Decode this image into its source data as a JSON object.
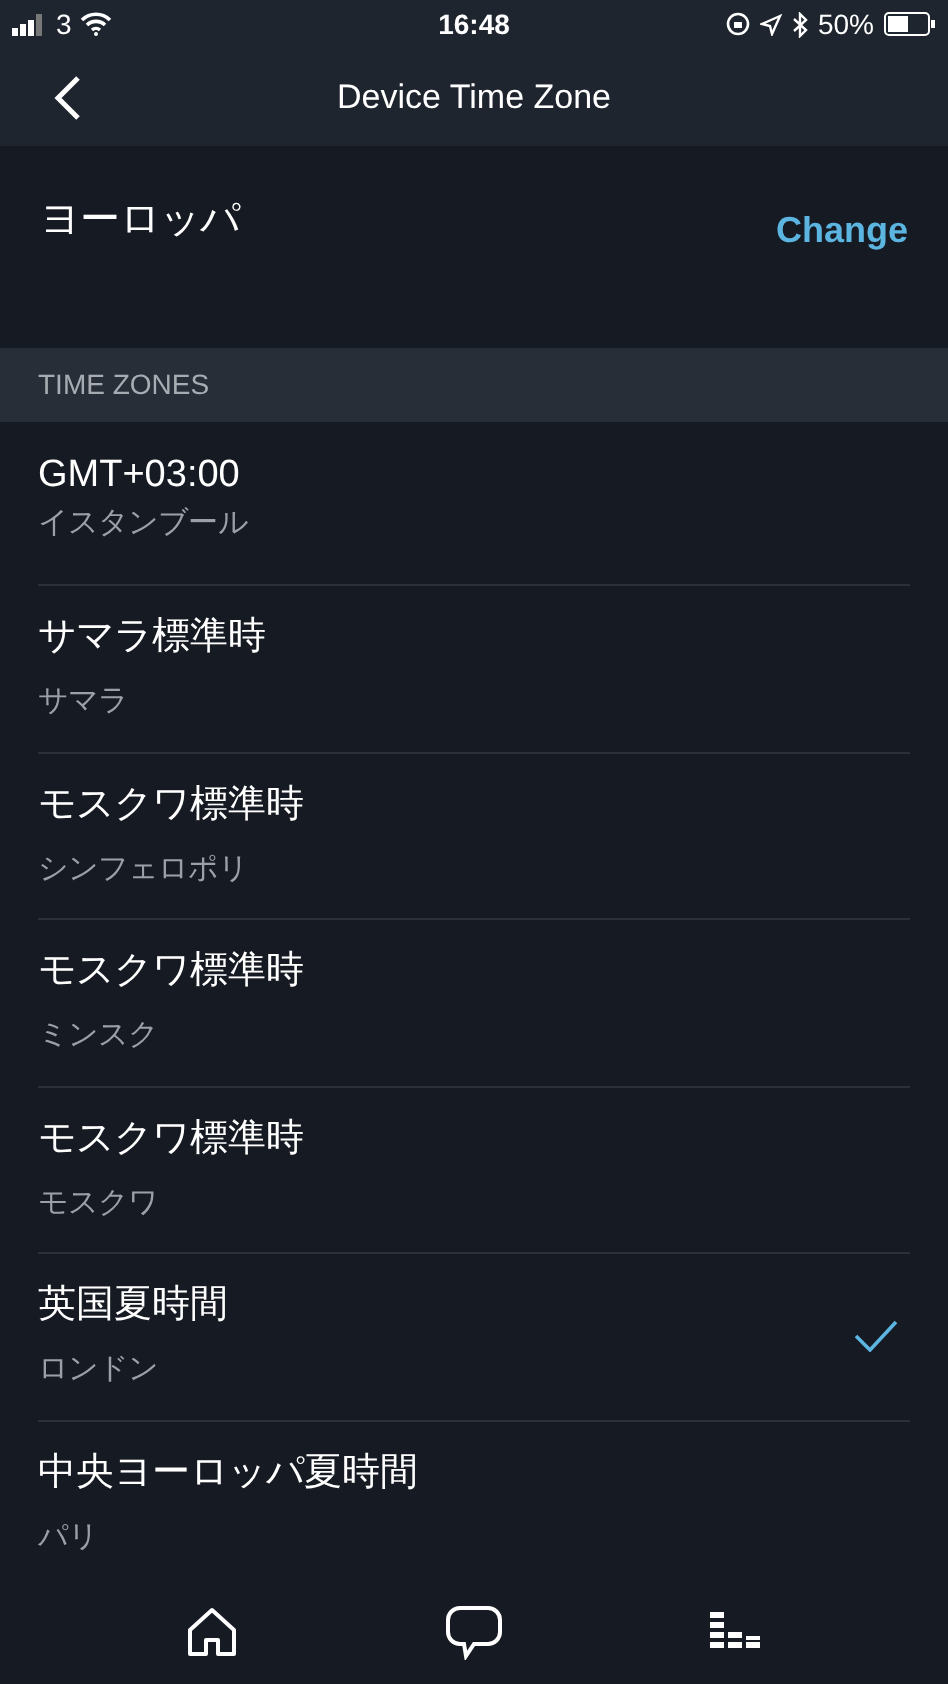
{
  "status_bar": {
    "carrier": "3",
    "time": "16:48",
    "battery": "50%"
  },
  "nav": {
    "title": "Device Time Zone"
  },
  "region": {
    "name": "ヨーロッパ",
    "action": "Change"
  },
  "section_header": "TIME ZONES",
  "time_zones": [
    {
      "name": "GMT+03:00",
      "city": "イスタンブール",
      "selected": false
    },
    {
      "name": "サマラ標準時",
      "city": "サマラ",
      "selected": false
    },
    {
      "name": "モスクワ標準時",
      "city": "シンフェロポリ",
      "selected": false
    },
    {
      "name": "モスクワ標準時",
      "city": "ミンスク",
      "selected": false
    },
    {
      "name": "モスクワ標準時",
      "city": "モスクワ",
      "selected": false
    },
    {
      "name": "英国夏時間",
      "city": "ロンドン",
      "selected": true
    },
    {
      "name": "中央ヨーロッパ夏時間",
      "city": "パリ",
      "selected": false
    }
  ]
}
